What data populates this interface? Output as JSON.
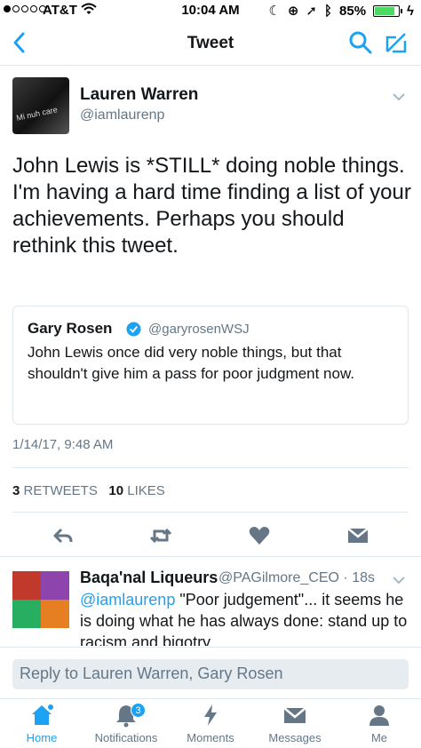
{
  "status_bar": {
    "carrier": "AT&T",
    "time": "10:04 AM",
    "battery": "85%",
    "signal_bars_filled": 1,
    "battery_level_pct": 85
  },
  "nav": {
    "title": "Tweet",
    "icons": [
      "back-chevron-icon",
      "search-icon",
      "compose-icon"
    ]
  },
  "tweet": {
    "author_name": "Lauren Warren",
    "author_handle": "@iamlaurenp",
    "avatar_caption": "Mi nuh care",
    "text": "John Lewis is *STILL* doing noble things. I'm having a hard time finding a list of your achievements. Perhaps you should rethink this tweet.",
    "quoted": {
      "name": "Gary Rosen",
      "handle": "@garyrosenWSJ",
      "verified": true,
      "text": "John Lewis once did very noble things, but that shouldn't give him a pass for poor judgment now."
    },
    "timestamp": "1/14/17, 9:48 AM",
    "retweets_count": "3",
    "retweets_label": "RETWEETS",
    "likes_count": "10",
    "likes_label": "LIKES"
  },
  "reply": {
    "name": "Baqa'nal Liqueurs",
    "handle": "@PAGilmore_CEO · 18s",
    "mention": "@iamlaurenp",
    "text": " \"Poor judgement\"... it seems he is doing what he has always done: stand up to racism and bigotry."
  },
  "reply_bar": {
    "placeholder": "Reply to Lauren Warren, Gary Rosen"
  },
  "tab_bar": {
    "tabs": [
      {
        "label": "Home",
        "icon": "home-icon",
        "active": true
      },
      {
        "label": "Notifications",
        "icon": "bell-icon",
        "badge": "3"
      },
      {
        "label": "Moments",
        "icon": "lightning-icon"
      },
      {
        "label": "Messages",
        "icon": "envelope-icon"
      },
      {
        "label": "Me",
        "icon": "person-icon"
      }
    ]
  },
  "colors": {
    "accent": "#1da1f2",
    "text": "#14171a",
    "secondary_text": "#657786",
    "divider": "#e1e8ed",
    "battery": "#4cd964"
  }
}
